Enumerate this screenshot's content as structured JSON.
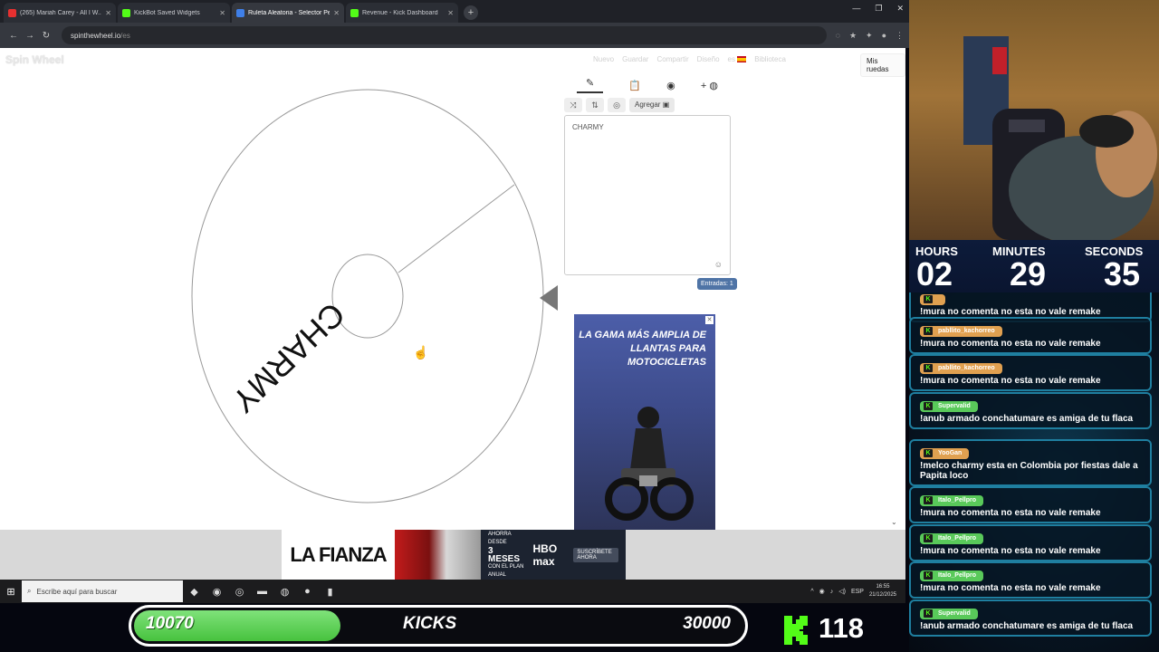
{
  "browser": {
    "tabs": [
      {
        "title": "(265) Mariah Carey - All I W...",
        "color": "#e63030"
      },
      {
        "title": "KickBot Saved Widgets",
        "color": "#53fc18"
      },
      {
        "title": "Ruleta Aleatoria - Selector Pers...",
        "color": "#3f7fe8"
      },
      {
        "title": "Revenue - Kick Dashboard",
        "color": "#53fc18"
      }
    ],
    "url_host": "spinthewheel.io",
    "url_path": "/es"
  },
  "app": {
    "logo": "Spin Wheel",
    "menu": [
      "Nuevo",
      "Guardar",
      "Compartir",
      "Diseño",
      "es",
      "Biblioteca"
    ],
    "my_wheels": "Mis ruedas",
    "wheel_label": "CHARMY",
    "add_label": "Agregar",
    "entries_text": "CHARMY",
    "entries_count": "Entradas: 1"
  },
  "ads": {
    "side_headline": "LA GAMA MÁS AMPLIA DE LLANTAS PARA MOTOCICLETAS",
    "banner_title": "LA FIANZA",
    "banner_promo_top": "AHORRA DESDE",
    "banner_promo_big": "3 MESES",
    "banner_promo_bottom": "CON EL PLAN ANUAL",
    "banner_logo": "HBO max",
    "banner_cta": "SUSCRÍBETE AHORA"
  },
  "taskbar": {
    "search_placeholder": "Escribe aquí para buscar",
    "lang": "ESP",
    "time": "16:55",
    "date": "21/12/2025"
  },
  "kicks": {
    "current": "10070",
    "label": "KICKS",
    "goal": "30000",
    "progress": 0.336,
    "followers": "118"
  },
  "timer": {
    "hours_label": "HOURS",
    "minutes_label": "MINUTES",
    "seconds_label": "SECONDS",
    "hours": "02",
    "minutes": "29",
    "seconds": "35"
  },
  "chat": [
    {
      "user": "",
      "text": "!mura no comenta no esta no vale remake",
      "badge_color": "#e0a050"
    },
    {
      "user": "pabllito_kachorreo",
      "text": "!mura no comenta no esta no vale remake",
      "badge_color": "#e0a050"
    },
    {
      "user": "pabllito_kachorreo",
      "text": "!mura no comenta no esta no vale remake",
      "badge_color": "#e0a050"
    },
    {
      "user": "Supervalid",
      "text": "!anub armado conchatumare es amiga de tu flaca",
      "badge_color": "#59c95a"
    },
    {
      "user": "YooGan",
      "text": "!melco charmy esta en Colombia por fiestas dale a Papita loco",
      "badge_color": "#e0a050"
    },
    {
      "user": "Italo_Pellpro",
      "text": "!mura no comenta no esta no vale remake",
      "badge_color": "#59c95a"
    },
    {
      "user": "Italo_Pellpro",
      "text": "!mura no comenta no esta no vale remake",
      "badge_color": "#59c95a"
    },
    {
      "user": "Italo_Pellpro",
      "text": "!mura no comenta no esta no vale remake",
      "badge_color": "#59c95a"
    },
    {
      "user": "Supervalid",
      "text": "!anub armado conchatumare es amiga de tu flaca",
      "badge_color": "#59c95a"
    }
  ]
}
